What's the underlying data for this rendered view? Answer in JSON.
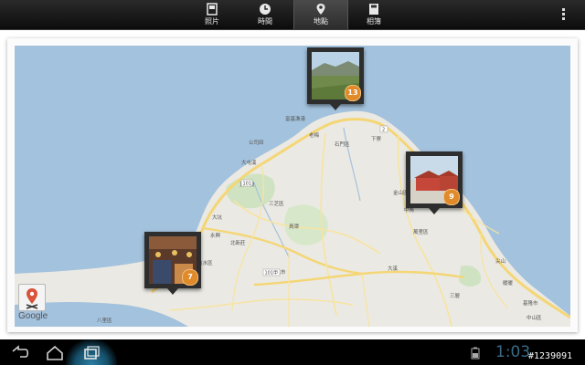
{
  "tabs": [
    {
      "label": "照片",
      "icon": "photo-icon",
      "active": false
    },
    {
      "label": "時間",
      "icon": "clock-icon",
      "active": false
    },
    {
      "label": "地點",
      "icon": "location-pin-icon",
      "active": true
    },
    {
      "label": "相簿",
      "icon": "album-icon",
      "active": false
    }
  ],
  "map": {
    "attribution": "Google",
    "place_labels": [
      "新北市",
      "石門區",
      "金山區",
      "萬里區",
      "三芝區",
      "淡水區",
      "大坑",
      "下寮",
      "大屯溪",
      "富基漁港",
      "老梅",
      "中角",
      "員潭",
      "頂中股",
      "基隆市",
      "中山區",
      "八里區",
      "北新莊",
      "永興",
      "大溪",
      "三層",
      "公司田",
      "尖山",
      "暖暖"
    ],
    "road_labels": [
      "101",
      "101甲",
      "2"
    ],
    "pins": [
      {
        "count": "13",
        "label": "pin-13"
      },
      {
        "count": "9",
        "label": "pin-9"
      },
      {
        "count": "7",
        "label": "pin-7"
      }
    ]
  },
  "navbar": {
    "clock": "1:03",
    "overlay_text": "#1239091"
  },
  "colors": {
    "sea": "#a3c2dd",
    "land": "#ebe9e3",
    "road": "#f4d675",
    "badge": "#e08a2a",
    "bar": "#0c0c0c"
  }
}
